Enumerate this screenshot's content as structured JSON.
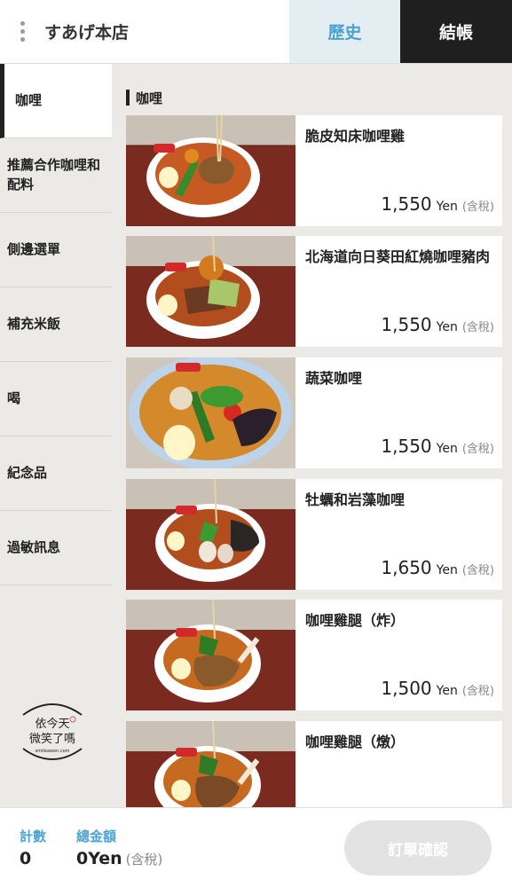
{
  "header": {
    "store_name": "すあげ本店",
    "history_label": "歷史",
    "checkout_label": "結帳",
    "colors": {
      "history_bg": "#e4eef2",
      "history_text": "#4aa3d2",
      "checkout_bg": "#1f1f1f"
    }
  },
  "sidebar": {
    "items": [
      {
        "label": "咖哩",
        "active": true
      },
      {
        "label": "推薦合作咖哩和配料",
        "active": false
      },
      {
        "label": "側邊選單",
        "active": false
      },
      {
        "label": "補充米飯",
        "active": false
      },
      {
        "label": "喝",
        "active": false
      },
      {
        "label": "紀念品",
        "active": false
      },
      {
        "label": "過敏訊息",
        "active": false
      }
    ],
    "logo": {
      "line1": "依今天",
      "line2": "微笑了嗎",
      "line3": "smileawen.com"
    }
  },
  "main": {
    "section_title": "咖哩",
    "items": [
      {
        "name": "脆皮知床咖哩雞",
        "price": "1,550",
        "unit": "Yen",
        "tax": "(含稅)",
        "image": "chicken-curry-bowl"
      },
      {
        "name": "北海道向日葵田紅燒咖哩豬肉",
        "price": "1,550",
        "unit": "Yen",
        "tax": "(含稅)",
        "image": "pork-curry-bowl"
      },
      {
        "name": "蔬菜咖哩",
        "price": "1,550",
        "unit": "Yen",
        "tax": "(含稅)",
        "image": "vegetable-curry-bowl"
      },
      {
        "name": "牡蠣和岩藻咖哩",
        "price": "1,650",
        "unit": "Yen",
        "tax": "(含稅)",
        "image": "oyster-curry-bowl"
      },
      {
        "name": "咖哩雞腿（炸）",
        "price": "1,500",
        "unit": "Yen",
        "tax": "(含稅)",
        "image": "fried-chicken-leg-curry-bowl"
      },
      {
        "name": "咖哩雞腿（燉）",
        "price": "",
        "unit": "",
        "tax": "",
        "image": "stewed-chicken-leg-curry-bowl"
      }
    ]
  },
  "footer": {
    "count_label": "計數",
    "total_label": "總金額",
    "count_value": "0",
    "total_value": "0Yen",
    "total_tax": "(含稅)",
    "order_button": "訂單確認"
  }
}
